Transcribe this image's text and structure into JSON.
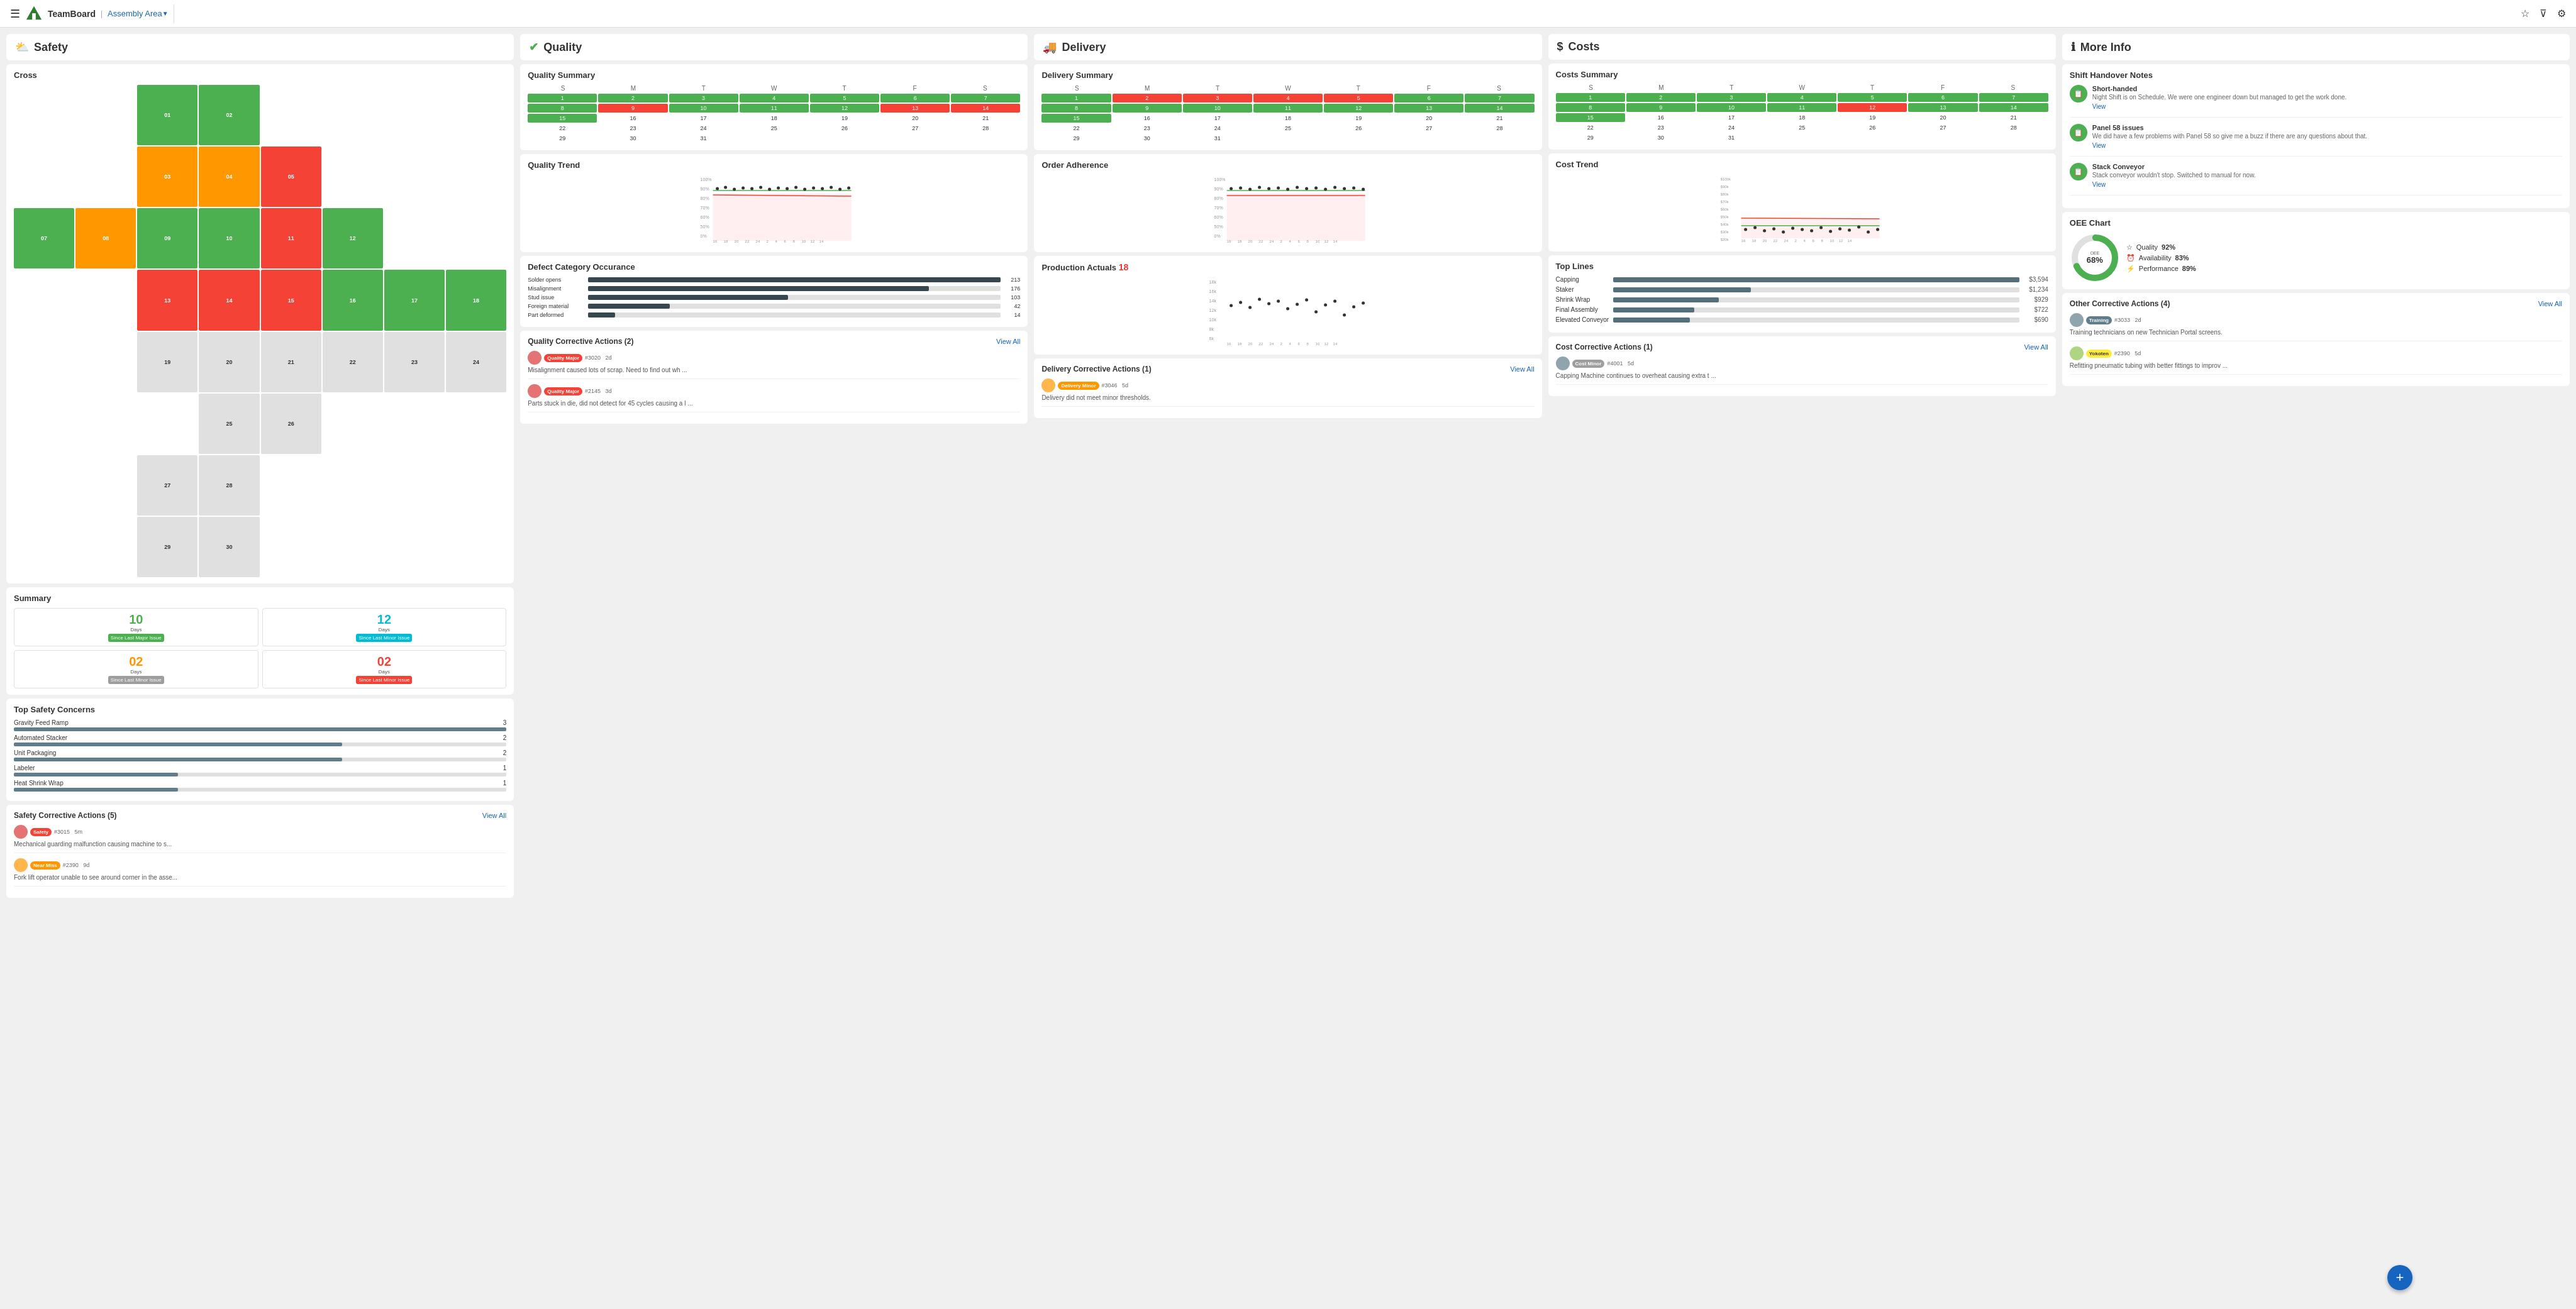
{
  "header": {
    "brand": "TeamBoard",
    "area": "Assembly Area",
    "menu_icon": "☰"
  },
  "columns": {
    "safety": {
      "label": "Safety",
      "icon": "⛅"
    },
    "quality": {
      "label": "Quality",
      "icon": "✔"
    },
    "delivery": {
      "label": "Delivery",
      "icon": "🚚"
    },
    "costs": {
      "label": "Costs",
      "icon": "$"
    },
    "more_info": {
      "label": "More Info",
      "icon": "ℹ"
    }
  },
  "safety": {
    "cross_title": "Cross",
    "summary_title": "Summary",
    "summary_items": [
      {
        "days": "10",
        "color": "green",
        "label": "Since Last Major Issue",
        "label_color": "green"
      },
      {
        "days": "12",
        "color": "teal",
        "label": "Since Last Minor Issue",
        "label_color": "teal"
      },
      {
        "days": "02",
        "color": "orange",
        "label": "Since Last Minor Issue",
        "label_color": "gray"
      },
      {
        "days": "02",
        "color": "red",
        "label": "Since Last Minor Issue",
        "label_color": "red"
      }
    ],
    "top_concerns_title": "Top Safety Concerns",
    "concerns": [
      {
        "name": "Gravity Feed Ramp",
        "value": 3,
        "max": 3
      },
      {
        "name": "Automated Stacker",
        "value": 2,
        "max": 3
      },
      {
        "name": "Unit Packaging",
        "value": 2,
        "max": 3
      },
      {
        "name": "Labeler",
        "value": 1,
        "max": 3
      },
      {
        "name": "Heat Shrink Wrap",
        "value": 1,
        "max": 3
      }
    ],
    "ca_title": "Safety Corrective Actions (5)",
    "ca_view_all": "View All",
    "corrective_actions": [
      {
        "badge": "Safety",
        "badge_class": "badge-safety",
        "number": "#3015",
        "time": "5m",
        "text": "Mechanical guarding malfunction causing machine to s..."
      },
      {
        "badge": "Near Miss",
        "badge_class": "badge-near-miss",
        "number": "#2390",
        "time": "9d",
        "text": "Fork lift operator unable to see around corner in the asse..."
      }
    ]
  },
  "quality": {
    "summary_title": "Quality Summary",
    "trend_title": "Quality Trend",
    "defect_title": "Defect Category Occurance",
    "defects": [
      {
        "name": "Solder opens",
        "value": 213,
        "max": 213
      },
      {
        "name": "Misalignment",
        "value": 176,
        "max": 213
      },
      {
        "name": "Stud issue",
        "value": 103,
        "max": 213
      },
      {
        "name": "Foreign material",
        "value": 42,
        "max": 213
      },
      {
        "name": "Part deformed",
        "value": 14,
        "max": 213
      }
    ],
    "ca_title": "Quality Corrective Actions (2)",
    "ca_view_all": "View All",
    "corrective_actions": [
      {
        "badge": "Quality Major",
        "badge_class": "badge-quality-major",
        "number": "#3020",
        "time": "2d",
        "text": "Misalignment caused lots of scrap. Need to find out wh ..."
      },
      {
        "badge": "Quality Major",
        "badge_class": "badge-quality-major",
        "number": "#2145",
        "time": "3d",
        "text": "Parts stuck in die, did not detect for 45 cycles causing a l ..."
      }
    ]
  },
  "delivery": {
    "summary_title": "Delivery Summary",
    "order_title": "Order Adherence",
    "production_title": "Production Actuals",
    "production_value": "18",
    "ca_title": "Delivery Corrective Actions (1)",
    "ca_view_all": "View All",
    "corrective_actions": [
      {
        "badge": "Delivery Minor",
        "badge_class": "badge-delivery-minor",
        "number": "#3046",
        "time": "5d",
        "text": "Delivery did not meet minor thresholds."
      }
    ]
  },
  "costs": {
    "summary_title": "Costs Summary",
    "trend_title": "Cost Trend",
    "top_lines_title": "Top Lines",
    "lines": [
      {
        "name": "Capping",
        "value": "$3,594",
        "pct": 100
      },
      {
        "name": "Staker",
        "value": "$1,234",
        "pct": 34
      },
      {
        "name": "Shrink Wrap",
        "value": "$929",
        "pct": 26
      },
      {
        "name": "Final Assembly",
        "value": "$722",
        "pct": 20
      },
      {
        "name": "Elevated Conveyor",
        "value": "$690",
        "pct": 19
      }
    ],
    "ca_title": "Cost Corrective Actions (1)",
    "ca_view_all": "View All",
    "corrective_actions": [
      {
        "badge": "Cost Minor",
        "badge_class": "badge-cost-minor",
        "number": "#4001",
        "time": "5d",
        "text": "Capping Machine continues to overheat causing extra t ..."
      }
    ]
  },
  "more_info": {
    "notes_title": "Shift Handover Notes",
    "notes": [
      {
        "title": "Short-handed",
        "text": "Night Shift is on Schedule. We were one engineer down but managed to get the work done.",
        "link": "View"
      },
      {
        "title": "Panel 58 issues",
        "text": "We did have a few problems with Panel 58 so give me a buzz if there are any questions about that.",
        "link": "View"
      },
      {
        "title": "Stack Conveyor",
        "text": "Stack conveyor wouldn't stop. Switched to manual for now.",
        "link": "View"
      }
    ],
    "oee_title": "OEE Chart",
    "oee_percent": "68%",
    "oee_label": "OEE",
    "oee_quality": "92%",
    "oee_availability": "83%",
    "oee_performance": "89%",
    "other_ca_title": "Other Corrective Actions (4)",
    "other_ca_view_all": "View All",
    "corrective_actions": [
      {
        "badge": "Training",
        "badge_class": "badge-training",
        "number": "#3033",
        "time": "2d",
        "text": "Training technicians on new Technician Portal screens."
      },
      {
        "badge": "Yokoten",
        "badge_class": "badge-yokoten",
        "number": "#2390",
        "time": "5d",
        "text": "Refitting pneumatic tubing with better fittings to improv ..."
      }
    ]
  },
  "cal_days": {
    "headers": [
      "S",
      "M",
      "T",
      "W",
      "T",
      "F",
      "S"
    ]
  }
}
